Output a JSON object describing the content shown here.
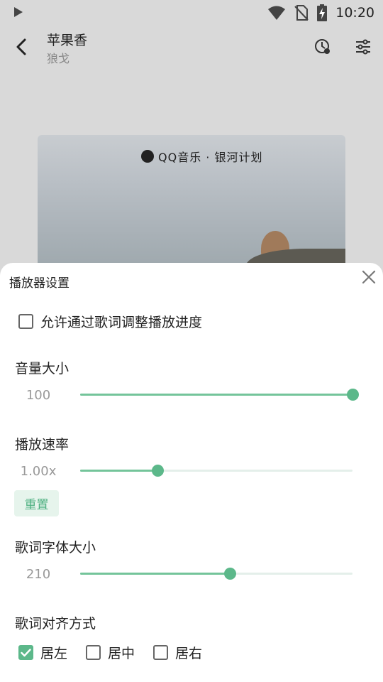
{
  "status_bar": {
    "time": "10:20",
    "icons": [
      "play-icon",
      "wifi-icon",
      "no-sim-icon",
      "battery-charging-icon"
    ]
  },
  "header": {
    "title": "苹果香",
    "artist": "狼戈",
    "icons": [
      "back-icon",
      "timer-icon",
      "equalizer-icon"
    ]
  },
  "cover": {
    "brand": "QQ音乐 · 银河计划"
  },
  "sheet": {
    "title": "播放器设置",
    "allow_seek_label": "允许通过歌词调整播放进度",
    "allow_seek_checked": false,
    "volume": {
      "label": "音量大小",
      "value_text": "100",
      "fraction": 1.0
    },
    "speed": {
      "label": "播放速率",
      "value_text": "1.00x",
      "fraction": 0.285,
      "reset_label": "重置"
    },
    "font_size": {
      "label": "歌词字体大小",
      "value_text": "210",
      "fraction": 0.55
    },
    "alignment": {
      "label": "歌词对齐方式",
      "options": [
        {
          "label": "居左",
          "checked": true
        },
        {
          "label": "居中",
          "checked": false
        },
        {
          "label": "居右",
          "checked": false
        }
      ]
    }
  },
  "colors": {
    "accent": "#5cb88a",
    "track": "#e4efea",
    "reset_bg": "#e6f4ec"
  }
}
